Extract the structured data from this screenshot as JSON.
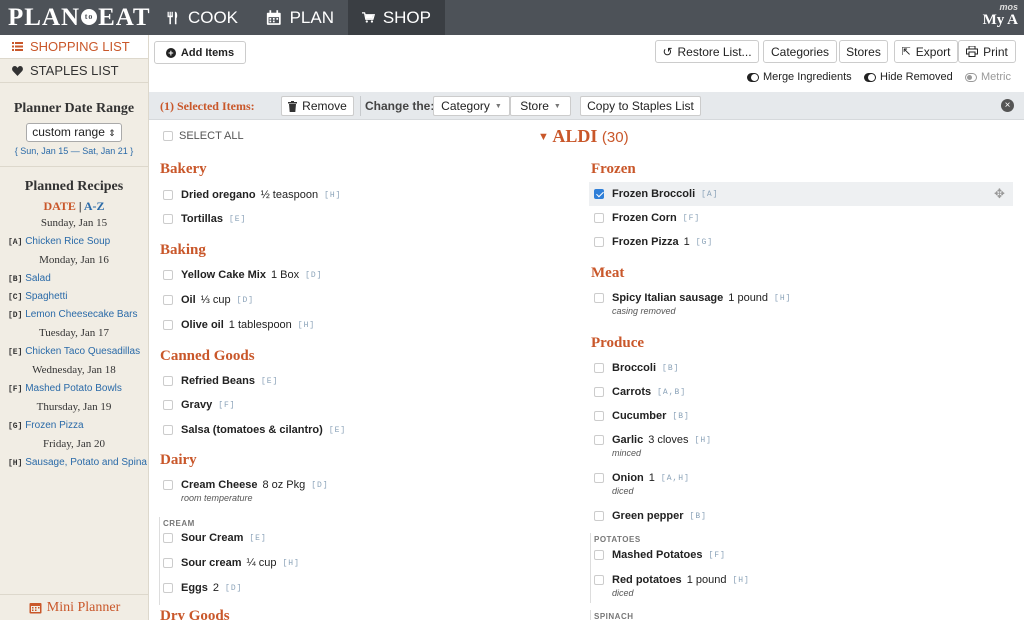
{
  "nav": {
    "logo": "PLAN",
    "logo_mid": "to",
    "logo_end": "EAT",
    "tabs": [
      {
        "label": "COOK",
        "icon": "fork-knife-icon"
      },
      {
        "label": "PLAN",
        "icon": "calendar-icon"
      },
      {
        "label": "SHOP",
        "icon": "cart-icon"
      }
    ],
    "account_small": "mos",
    "account_big": "My A"
  },
  "sidebar": {
    "shopping_list": "SHOPPING LIST",
    "staples_list": "STAPLES LIST",
    "date_range_title": "Planner Date Range",
    "range_value": "custom range",
    "range_dates": "{ Sun, Jan 15 — Sat, Jan 21 }",
    "planned_title": "Planned Recipes",
    "sort_date": "DATE",
    "sort_sep": "|",
    "sort_az": "A-Z",
    "days": [
      {
        "day": "Sunday, Jan 15",
        "recipes": [
          {
            "tag": "[A]",
            "name": "Chicken Rice Soup"
          }
        ]
      },
      {
        "day": "Monday, Jan 16",
        "recipes": [
          {
            "tag": "[B]",
            "name": "Salad"
          },
          {
            "tag": "[C]",
            "name": "Spaghetti"
          },
          {
            "tag": "[D]",
            "name": "Lemon Cheesecake Bars"
          }
        ]
      },
      {
        "day": "Tuesday, Jan 17",
        "recipes": [
          {
            "tag": "[E]",
            "name": "Chicken Taco Quesadillas"
          }
        ]
      },
      {
        "day": "Wednesday, Jan 18",
        "recipes": [
          {
            "tag": "[F]",
            "name": "Mashed Potato Bowls"
          }
        ]
      },
      {
        "day": "Thursday, Jan 19",
        "recipes": [
          {
            "tag": "[G]",
            "name": "Frozen Pizza"
          }
        ]
      },
      {
        "day": "Friday, Jan 20",
        "recipes": [
          {
            "tag": "[H]",
            "name": "Sausage, Potato and Spina"
          }
        ]
      }
    ],
    "mini_planner": "Mini Planner"
  },
  "toolbar": {
    "add_items": "Add Items",
    "restore_list": "Restore List...",
    "categories": "Categories",
    "stores": "Stores",
    "export": "Export",
    "print": "Print",
    "merge_ingredients": "Merge Ingredients",
    "hide_removed": "Hide Removed",
    "metric": "Metric"
  },
  "selection": {
    "label": "(1) Selected Items:",
    "remove": "Remove",
    "change_the": "Change the:",
    "category": "Category",
    "store": "Store",
    "copy_staples": "Copy to Staples List"
  },
  "list": {
    "select_all": "SELECT ALL",
    "store_name": "ALDI",
    "store_count": "(30)",
    "left": {
      "bakery": {
        "title": "Bakery",
        "items": [
          {
            "name": "Dried oregano",
            "qty": "½ teaspoon",
            "tag": "[H]"
          },
          {
            "name": "Tortillas",
            "qty": "",
            "tag": "[E]"
          }
        ]
      },
      "baking": {
        "title": "Baking",
        "items": [
          {
            "name": "Yellow Cake Mix",
            "qty": "1 Box",
            "tag": "[D]"
          },
          {
            "name": "Oil",
            "qty": "⅓ cup",
            "tag": "[D]"
          },
          {
            "name": "Olive oil",
            "qty": "1 tablespoon",
            "tag": "[H]"
          }
        ]
      },
      "canned": {
        "title": "Canned Goods",
        "items": [
          {
            "name": "Refried Beans",
            "qty": "",
            "tag": "[E]"
          },
          {
            "name": "Gravy",
            "qty": "",
            "tag": "[F]"
          },
          {
            "name": "Salsa (tomatoes & cilantro)",
            "qty": "",
            "tag": "[E]"
          }
        ]
      },
      "dairy": {
        "title": "Dairy",
        "items": [
          {
            "name": "Cream Cheese",
            "qty": "8 oz Pkg",
            "tag": "[D]",
            "note": "room temperature"
          }
        ],
        "sub": {
          "title": "CREAM",
          "items": [
            {
              "name": "Sour Cream",
              "qty": "",
              "tag": "[E]"
            },
            {
              "name": "Sour cream",
              "qty": "¼ cup",
              "tag": "[H]"
            }
          ]
        },
        "after": [
          {
            "name": "Eggs",
            "qty": "2",
            "tag": "[D]"
          }
        ]
      },
      "drygoods": {
        "title": "Dry Goods"
      }
    },
    "right": {
      "frozen": {
        "title": "Frozen",
        "items": [
          {
            "name": "Frozen Broccoli",
            "qty": "",
            "tag": "[A]"
          },
          {
            "name": "Frozen Corn",
            "qty": "",
            "tag": "[F]"
          },
          {
            "name": "Frozen Pizza",
            "qty": "1",
            "tag": "[G]"
          }
        ]
      },
      "meat": {
        "title": "Meat",
        "items": [
          {
            "name": "Spicy Italian sausage",
            "qty": "1 pound",
            "tag": "[H]",
            "note": "casing removed"
          }
        ]
      },
      "produce": {
        "title": "Produce",
        "items": [
          {
            "name": "Broccoli",
            "qty": "",
            "tag": "[B]"
          },
          {
            "name": "Carrots",
            "qty": "",
            "tag": "[A,B]"
          },
          {
            "name": "Cucumber",
            "qty": "",
            "tag": "[B]"
          },
          {
            "name": "Garlic",
            "qty": "3 cloves",
            "tag": "[H]",
            "note": "minced"
          },
          {
            "name": "Onion",
            "qty": "1",
            "tag": "[A,H]",
            "note": "diced"
          },
          {
            "name": "Green pepper",
            "qty": "",
            "tag": "[B]"
          }
        ],
        "sub": {
          "title": "POTATOES",
          "items": [
            {
              "name": "Mashed Potatoes",
              "qty": "",
              "tag": "[F]"
            },
            {
              "name": "Red potatoes",
              "qty": "1 pound",
              "tag": "[H]",
              "note": "diced"
            }
          ]
        },
        "sub2": "SPINACH"
      }
    }
  }
}
